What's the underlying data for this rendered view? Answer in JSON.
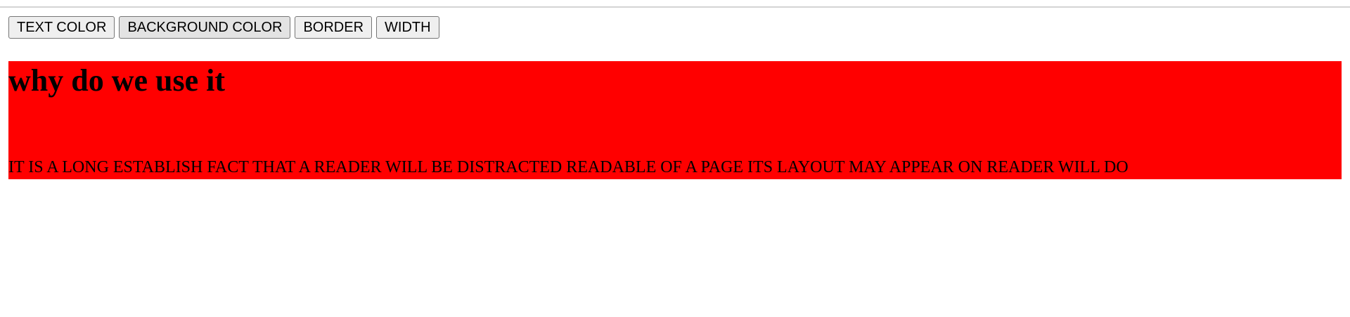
{
  "toolbar": {
    "buttons": [
      {
        "label": "TEXT COLOR"
      },
      {
        "label": "BACKGROUND COLOR"
      },
      {
        "label": "BORDER"
      },
      {
        "label": "WIDTH"
      }
    ]
  },
  "content": {
    "heading": "why do we use it",
    "paragraph": "IT IS A LONG ESTABLISH FACT THAT A READER WILL BE DISTRACTED READABLE OF A PAGE ITS LAYOUT MAY APPEAR ON READER WILL DO",
    "background_color": "#ff0000"
  }
}
